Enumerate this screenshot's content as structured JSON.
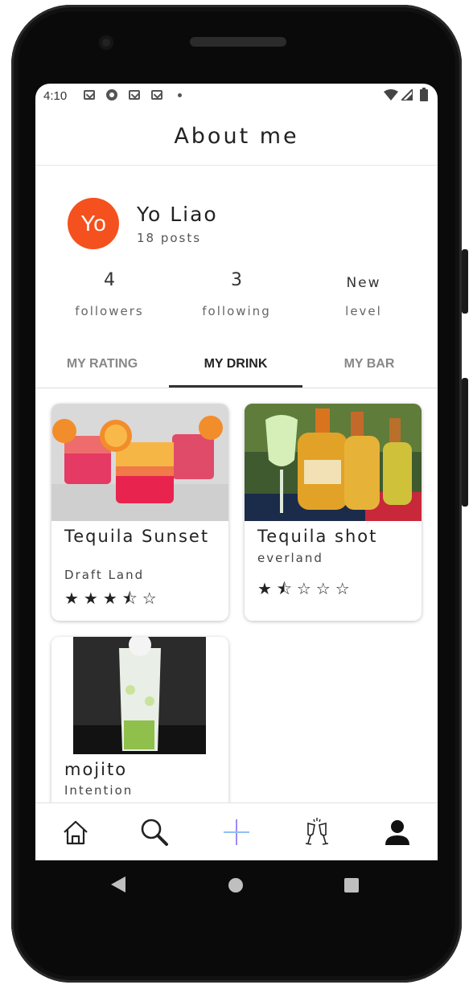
{
  "status_bar": {
    "time": "4:10"
  },
  "header": {
    "title": "About me"
  },
  "profile": {
    "avatar_initials": "Yo",
    "avatar_color": "#f4511e",
    "name": "Yo Liao",
    "posts": "18 posts"
  },
  "stats": [
    {
      "value": "4",
      "label": "followers"
    },
    {
      "value": "3",
      "label": "following"
    },
    {
      "value": "New",
      "label": "level"
    }
  ],
  "tabs": [
    {
      "label": "MY RATING"
    },
    {
      "label": "MY DRINK",
      "active": true
    },
    {
      "label": "MY BAR"
    }
  ],
  "drinks": [
    {
      "name": "Tequila Sunset",
      "bar": "Draft Land",
      "rating": 3.5,
      "stars": "★★★⯪☆"
    },
    {
      "name": "Tequila shot",
      "bar": "everland",
      "rating": 1.5,
      "stars": "★⯪☆☆☆"
    },
    {
      "name": "mojito",
      "bar": "Intention"
    }
  ],
  "bottom_nav": [
    {
      "icon": "home-icon"
    },
    {
      "icon": "search-icon"
    },
    {
      "icon": "plus-icon"
    },
    {
      "icon": "cheers-icon"
    },
    {
      "icon": "profile-icon"
    }
  ]
}
